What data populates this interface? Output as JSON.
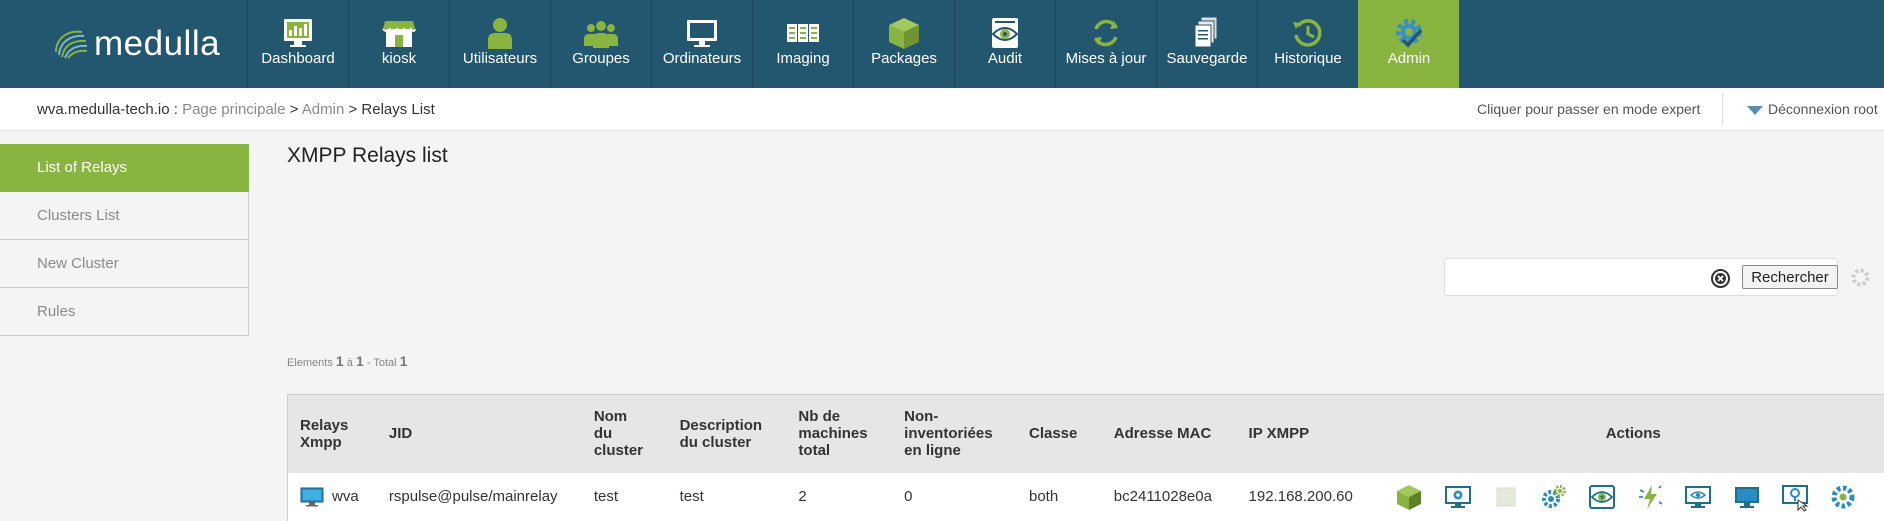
{
  "app": {
    "logo_text": "medulla"
  },
  "nav": [
    {
      "label": "Dashboard",
      "icon": "dashboard-icon"
    },
    {
      "label": "kiosk",
      "icon": "kiosk-icon"
    },
    {
      "label": "Utilisateurs",
      "icon": "user-icon"
    },
    {
      "label": "Groupes",
      "icon": "group-icon"
    },
    {
      "label": "Ordinateurs",
      "icon": "monitor-icon"
    },
    {
      "label": "Imaging",
      "icon": "imaging-icon"
    },
    {
      "label": "Packages",
      "icon": "package-icon"
    },
    {
      "label": "Audit",
      "icon": "audit-eye-icon"
    },
    {
      "label": "Mises à jour",
      "icon": "update-icon"
    },
    {
      "label": "Sauvegarde",
      "icon": "backup-icon"
    },
    {
      "label": "Historique",
      "icon": "history-icon"
    },
    {
      "label": "Admin",
      "icon": "admin-gear-icon",
      "active": true
    }
  ],
  "breadcrumb": {
    "server": "wva.medulla-tech.io",
    "sep1": " : ",
    "home": "Page principale",
    "sep2": " > ",
    "admin": "Admin",
    "sep3": " > ",
    "current": "Relays List"
  },
  "header_right": {
    "expert_mode": "Cliquer pour passer en mode expert",
    "logout": "Déconnexion root"
  },
  "sidebar": {
    "items": [
      {
        "label": "List of Relays",
        "active": true
      },
      {
        "label": "Clusters List"
      },
      {
        "label": "New Cluster"
      },
      {
        "label": "Rules"
      }
    ]
  },
  "main": {
    "title": "XMPP Relays list",
    "search": {
      "placeholder": "",
      "value": "",
      "button": "Rechercher"
    },
    "pagination": {
      "elements": "Elements",
      "from": "1",
      "a": "à",
      "to": "1",
      "total_label": "- Total",
      "total": "1"
    },
    "table": {
      "headers": {
        "relay": [
          "Relays",
          "Xmpp"
        ],
        "jid": "JID",
        "cluster_name": [
          "Nom",
          "du",
          "cluster"
        ],
        "cluster_desc": [
          "Description",
          "du cluster"
        ],
        "nb_machines": [
          "Nb de",
          "machines",
          "total"
        ],
        "non_inventoried": [
          "Non-",
          "inventoriées",
          "en ligne"
        ],
        "classe": "Classe",
        "mac": "Adresse MAC",
        "ip": "IP XMPP",
        "actions": "Actions"
      },
      "rows": [
        {
          "relay": "wva",
          "jid": "rspulse@pulse/mainrelay",
          "cluster_name": "test",
          "cluster_desc": "test",
          "nb_machines": "2",
          "non_inventoried": "0",
          "classe": "both",
          "mac": "bc2411028e0a",
          "ip": "192.168.200.60",
          "action_icons": [
            "package-cube-icon",
            "monitor-settings-icon",
            "disabled-square-icon",
            "gears-icon",
            "audit-eye-icon",
            "lightning-icon",
            "monitor-eye-icon",
            "monitor-icon",
            "remote-desktop-icon",
            "gear-partial-icon"
          ]
        }
      ]
    }
  },
  "colors": {
    "topbar": "#23566f",
    "accent": "#8ab440",
    "table_header": "#e6e6e6"
  }
}
